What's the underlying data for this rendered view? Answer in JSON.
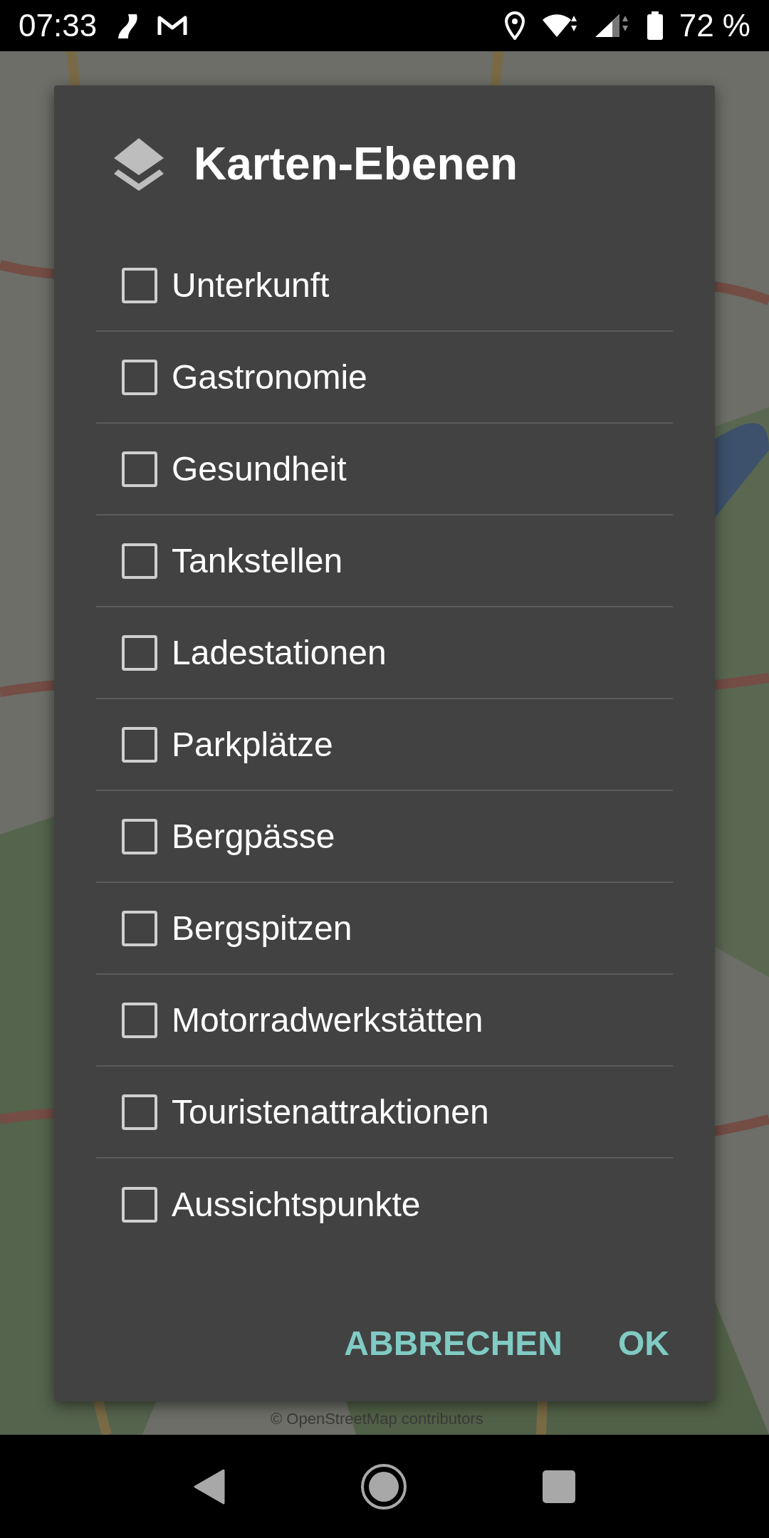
{
  "status_bar": {
    "time": "07:33",
    "battery": "72 %"
  },
  "dialog": {
    "title": "Karten-Ebenen",
    "options": [
      {
        "label": "Unterkunft",
        "checked": false
      },
      {
        "label": "Gastronomie",
        "checked": false
      },
      {
        "label": "Gesundheit",
        "checked": false
      },
      {
        "label": "Tankstellen",
        "checked": false
      },
      {
        "label": "Ladestationen",
        "checked": false
      },
      {
        "label": "Parkplätze",
        "checked": false
      },
      {
        "label": "Bergpässe",
        "checked": false
      },
      {
        "label": "Bergspitzen",
        "checked": false
      },
      {
        "label": "Motorradwerkstätten",
        "checked": false
      },
      {
        "label": "Touristenattraktionen",
        "checked": false
      },
      {
        "label": "Aussichtspunkte",
        "checked": false
      }
    ],
    "buttons": [
      "ABBRECHEN",
      "OK"
    ]
  },
  "map": {
    "attribution": "© OpenStreetMap contributors"
  }
}
